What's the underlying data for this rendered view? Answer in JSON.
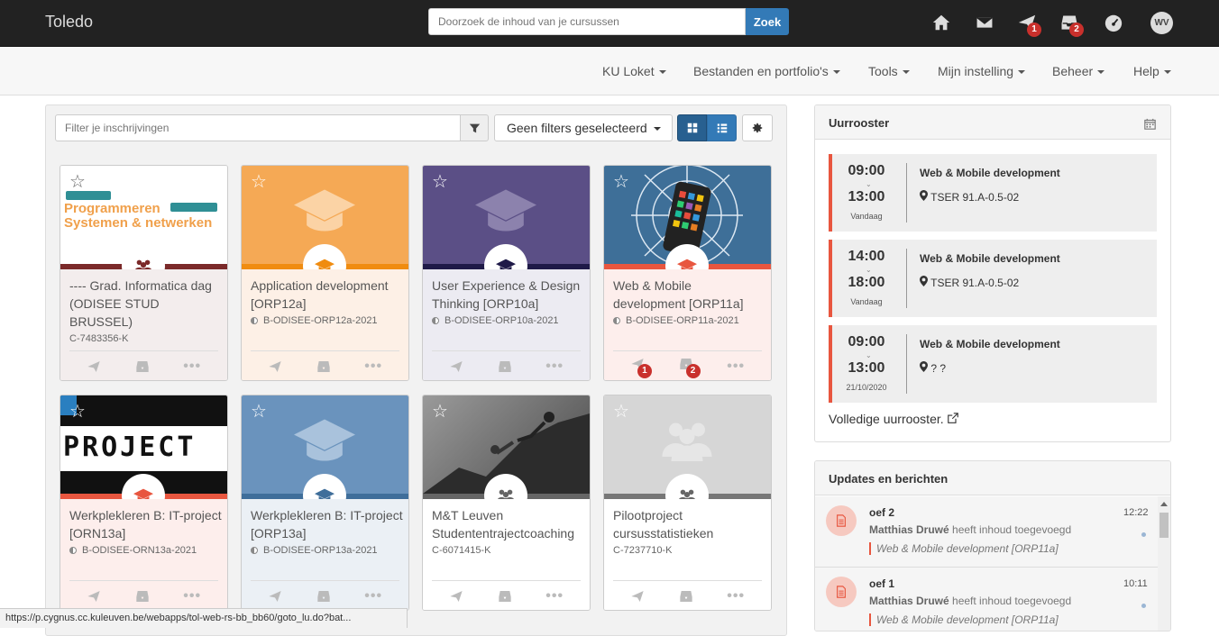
{
  "app": {
    "brand": "Toledo"
  },
  "search": {
    "placeholder": "Doorzoek de inhoud van je cursussen",
    "button": "Zoek"
  },
  "topbar": {
    "icons": [
      "home-icon",
      "mail-icon",
      "send-icon",
      "inbox-icon",
      "dashboard-icon"
    ],
    "send_badge": "1",
    "inbox_badge": "2",
    "avatar": "WV"
  },
  "nav": {
    "items": [
      "KU Loket",
      "Bestanden en portfolio's",
      "Tools",
      "Mijn instelling",
      "Beheer",
      "Help"
    ]
  },
  "filters": {
    "placeholder": "Filter je inschrijvingen",
    "select_label": "Geen filters geselecteerd"
  },
  "cards": [
    {
      "title": "---- Grad. Informatica dag (ODISEE STUD BRUSSEL)",
      "code": "C-7483356-K",
      "icon": "group-icon",
      "banner": "Programmeren Systemen & netwerken",
      "color": "#7b2a2a"
    },
    {
      "title": "Application development [ORP12a]",
      "code": "B-ODISEE-ORP12a-2021",
      "icon": "graduation-cap-icon",
      "color": "#f0a04b"
    },
    {
      "title": "User Experience & Design Thinking [ORP10a]",
      "code": "B-ODISEE-ORP10a-2021",
      "icon": "graduation-cap-icon",
      "color": "#584b7f"
    },
    {
      "title": "Web & Mobile development [ORP11a]",
      "code": "B-ODISEE-ORP11a-2021",
      "icon": "graduation-cap-icon",
      "color": "#e8563f",
      "send_badge": "1",
      "inbox_badge": "2"
    },
    {
      "title": "Werkplekleren B: IT-project [ORN13a]",
      "code": "B-ODISEE-ORN13a-2021",
      "icon": "graduation-cap-icon",
      "banner": "PROJECT",
      "color": "#e8563f"
    },
    {
      "title": "Werkplekleren B: IT-project [ORP13a]",
      "code": "B-ODISEE-ORP13a-2021",
      "icon": "graduation-cap-icon",
      "color": "#3f6e9a"
    },
    {
      "title": "M&T Leuven Studententrajectcoaching",
      "code": "C-6071415-K",
      "icon": "group-icon",
      "color": "#666666"
    },
    {
      "title": "Pilootproject cursusstatistieken",
      "code": "C-7237710-K",
      "icon": "group-icon",
      "color": "#777777"
    }
  ],
  "schedule": {
    "title": "Uurrooster",
    "slots": [
      {
        "start": "09:00",
        "end": "13:00",
        "day": "Vandaag",
        "course": "Web & Mobile development",
        "location": "TSER 91.A-0.5-02"
      },
      {
        "start": "14:00",
        "end": "18:00",
        "day": "Vandaag",
        "course": "Web & Mobile development",
        "location": "TSER 91.A-0.5-02"
      },
      {
        "start": "09:00",
        "end": "13:00",
        "day": "21/10/2020",
        "course": "Web & Mobile development",
        "location": "? ?"
      }
    ],
    "full_link": "Volledige uurrooster."
  },
  "updates": {
    "title": "Updates en berichten",
    "items": [
      {
        "name": "oef 2",
        "time": "12:22",
        "author": "Matthias Druwé",
        "action": "heeft inhoud toegevoegd",
        "course": "Web & Mobile development [ORP11a]"
      },
      {
        "name": "oef 1",
        "time": "10:11",
        "author": "Matthias Druwé",
        "action": "heeft inhoud toegevoegd",
        "course": "Web & Mobile development [ORP11a]"
      }
    ]
  },
  "status": {
    "url": "https://p.cygnus.cc.kuleuven.be/webapps/tol-web-rs-bb_bb60/goto_lu.do?bat..."
  }
}
